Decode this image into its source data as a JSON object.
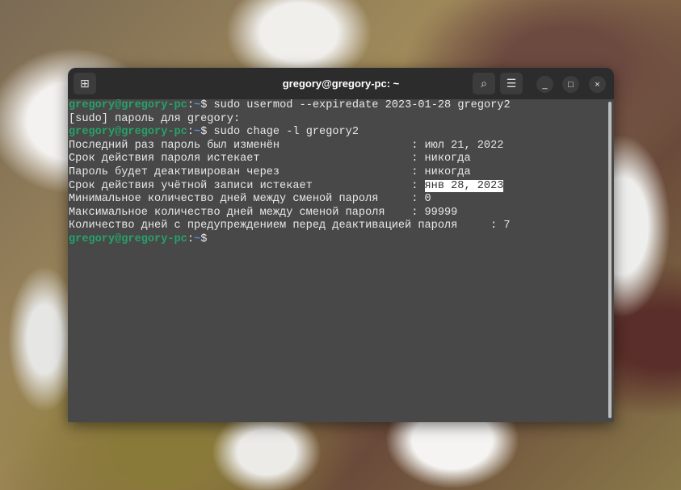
{
  "window": {
    "title": "gregory@gregory-pc: ~",
    "buttons": {
      "new_tab": "new-tab-icon",
      "search": "search-icon",
      "menu": "hamburger-menu-icon",
      "minimize": "_",
      "maximize": "□",
      "close": "×"
    }
  },
  "prompt": {
    "user_host": "gregory@gregory-pc",
    "path": "~",
    "colon": ":",
    "symbol": "$"
  },
  "lines": {
    "cmd1": " sudo usermod --expiredate 2023-01-28 gregory2",
    "sudo": "[sudo] пароль для gregory:",
    "cmd2": " sudo chage -l gregory2",
    "r1": "Последний раз пароль был изменён                    : июл 21, 2022",
    "r2": "Срок действия пароля истекает                       : никогда",
    "r3": "Пароль будет деактивирован через                    : никогда",
    "r4": "Срок действия учётной записи истекает               : ",
    "r4_value": "янв 28, 2023",
    "r5": "Минимальное количество дней между сменой пароля     : 0",
    "r6": "Максимальное количество дней между сменой пароля    : 99999",
    "r7": "Количество дней с предупреждением перед деактивацией пароля     : 7"
  }
}
